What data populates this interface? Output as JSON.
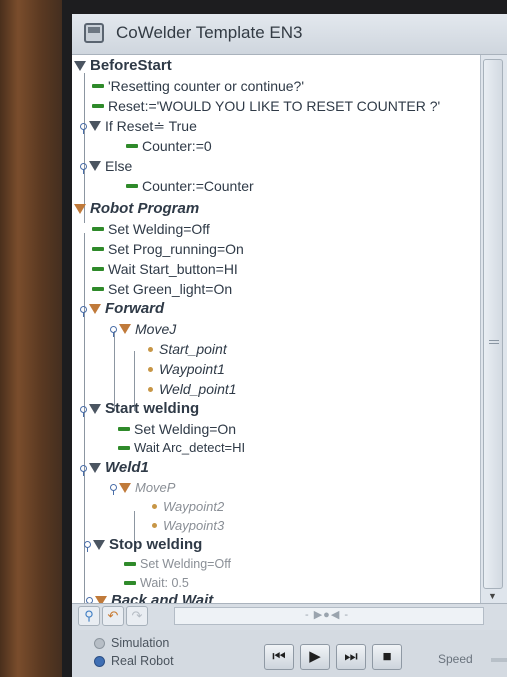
{
  "window": {
    "title": "CoWelder Template EN3"
  },
  "tree": [
    {
      "text": "BeforeStart",
      "icon": "expand-triangle",
      "style": "bold"
    },
    {
      "text": "'Resetting counter or continue?'",
      "icon": "command-dash"
    },
    {
      "text": "Reset:='WOULD YOU LIKE TO RESET COUNTER ?'",
      "icon": "command-dash"
    },
    {
      "text": "If Reset≐ True",
      "icon": "expand-triangle"
    },
    {
      "text": "Counter:=0",
      "icon": "command-dash"
    },
    {
      "text": "Else",
      "icon": "expand-triangle"
    },
    {
      "text": "Counter:=Counter",
      "icon": "command-dash"
    },
    {
      "text": "Robot Program",
      "icon": "expand-triangle",
      "style": "bold-italic"
    },
    {
      "text": "Set Welding=Off",
      "icon": "command-dash"
    },
    {
      "text": "Set Prog_running=On",
      "icon": "command-dash"
    },
    {
      "text": "Wait Start_button=HI",
      "icon": "command-dash"
    },
    {
      "text": "Set Green_light=On",
      "icon": "command-dash"
    },
    {
      "text": "Forward",
      "icon": "expand-triangle",
      "style": "bold-italic"
    },
    {
      "text": "MoveJ",
      "icon": "expand-triangle",
      "style": "italic"
    },
    {
      "text": "Start_point",
      "icon": "waypoint-dot",
      "style": "italic"
    },
    {
      "text": "Waypoint1",
      "icon": "waypoint-dot",
      "style": "italic"
    },
    {
      "text": "Weld_point1",
      "icon": "waypoint-dot",
      "style": "italic"
    },
    {
      "text": "Start welding",
      "icon": "expand-triangle",
      "style": "bold"
    },
    {
      "text": "Set Welding=On",
      "icon": "command-dash"
    },
    {
      "text": "Wait Arc_detect=HI",
      "icon": "command-dash"
    },
    {
      "text": "Weld1",
      "icon": "expand-triangle",
      "style": "bold-italic"
    },
    {
      "text": "MoveP",
      "icon": "expand-triangle",
      "style": "italic"
    },
    {
      "text": "Waypoint2",
      "icon": "waypoint-dot",
      "style": "italic"
    },
    {
      "text": "Waypoint3",
      "icon": "waypoint-dot",
      "style": "italic"
    },
    {
      "text": "Stop welding",
      "icon": "expand-triangle",
      "style": "bold"
    },
    {
      "text": "Set Welding=Off",
      "icon": "command-dash"
    },
    {
      "text": "Wait: 0.5",
      "icon": "command-dash"
    },
    {
      "text": "Back and Wait",
      "icon": "expand-triangle",
      "style": "bold-italic"
    }
  ],
  "toolbar": {
    "nav_glyphs": "- ▶●◀ -"
  },
  "mode": {
    "simulation_label": "Simulation",
    "real_robot_label": "Real Robot",
    "selected": "Real Robot"
  },
  "playback": {
    "speed_label": "Speed"
  },
  "colors": {
    "command": "#2f8a2a",
    "waypoint": "#c79646",
    "node_triangle": "#4b5561",
    "selected_radio": "#3f6fb4"
  }
}
